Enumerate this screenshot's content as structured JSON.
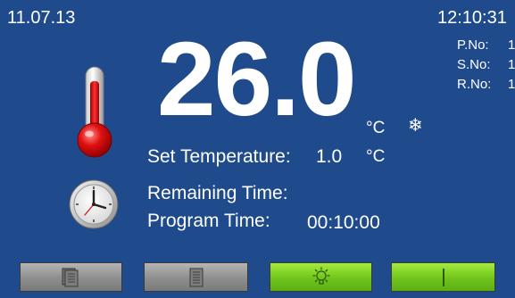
{
  "status": {
    "date": "11.07.13",
    "time": "12:10:31"
  },
  "info": {
    "items": [
      {
        "label": "P.No:",
        "value": "1"
      },
      {
        "label": "S.No:",
        "value": "1"
      },
      {
        "label": "R.No:",
        "value": "1"
      }
    ]
  },
  "temperature": {
    "current": "26.0",
    "unit": "°C",
    "snow_glyph": "❄",
    "set_label": "Set Temperature:",
    "set_value": "1.0",
    "set_unit": "°C"
  },
  "timer": {
    "remaining_label": "Remaining Time:",
    "remaining_value": "",
    "program_label": "Program Time:",
    "program_value": "00:10:00"
  },
  "icons": {
    "thermometer": "thermometer-icon",
    "clock": "clock-icon",
    "snowflake": "snowflake-icon",
    "multi_document": "multi-document-icon",
    "document": "document-icon",
    "light": "light-bulb-icon",
    "power": "power-icon"
  },
  "buttons": [
    {
      "name": "program-list",
      "style": "grey",
      "icon": "multi-document-icon"
    },
    {
      "name": "program",
      "style": "grey",
      "icon": "document-icon"
    },
    {
      "name": "light",
      "style": "green",
      "icon": "light-bulb-icon"
    },
    {
      "name": "start",
      "style": "green",
      "icon": "power-icon"
    }
  ],
  "colors": {
    "background": "#1f4a8c",
    "button_grey": "#9a9a9a",
    "button_green": "#72c81e",
    "text": "#ffffff"
  }
}
